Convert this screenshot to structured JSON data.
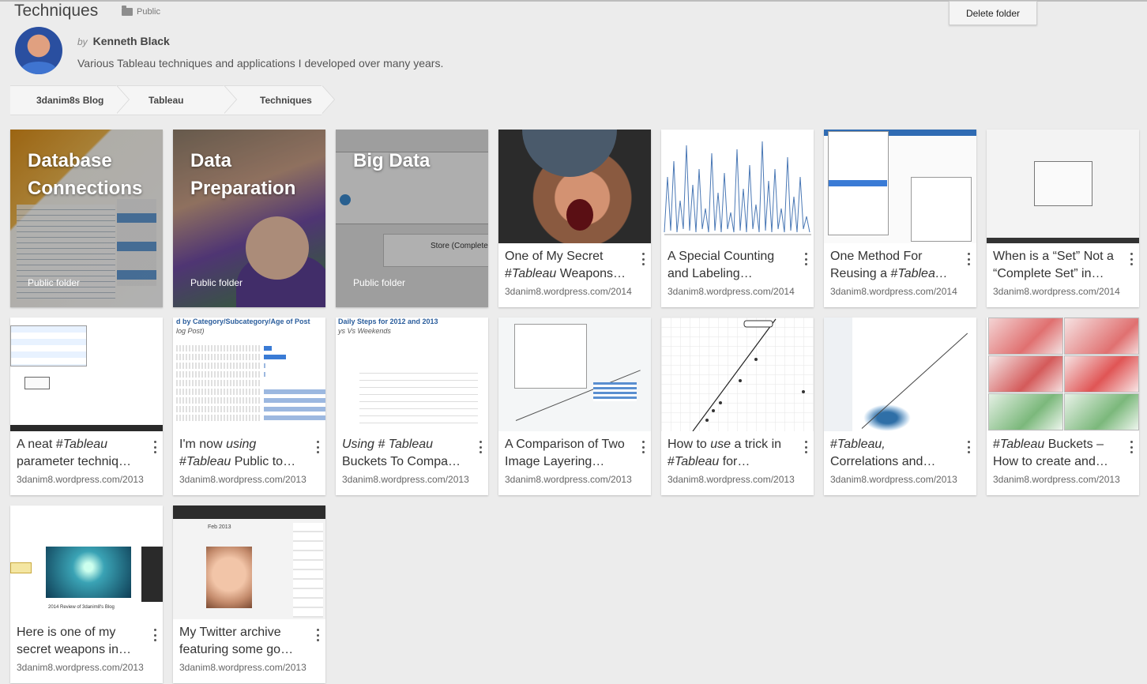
{
  "header": {
    "title": "Techniques",
    "visibility": "Public",
    "delete_label": "Delete folder",
    "by": "by",
    "author": "Kenneth Black",
    "description": "Various Tableau techniques and applications I developed over many years."
  },
  "breadcrumbs": [
    "3danim8s Blog",
    "Tableau",
    "Techniques"
  ],
  "folders": [
    {
      "title": "Database Connections",
      "sub": "Public folder"
    },
    {
      "title": "Data Preparation",
      "sub": "Public folder"
    },
    {
      "title": "Big Data",
      "sub": "Public folder"
    }
  ],
  "thumb_text": {
    "bars_header": "d by Category/Subcategory/Age of Post",
    "bars_sub": "log Post)",
    "steps_header": "Daily Steps for 2012 and 2013",
    "steps_sub": "ys Vs Weekends",
    "store": "Store (Complete",
    "fireworks": "2014 Review of 3danim8's Blog",
    "twitter": "Feb 2013"
  },
  "posts": [
    {
      "line1": [
        "One of My Secret",
        ""
      ],
      "line2": [
        "#",
        "Tableau",
        " Weapons…"
      ],
      "url": "3danim8.wordpress.com/2014"
    },
    {
      "line1": [
        "A Special Counting",
        ""
      ],
      "line2": [
        "and Labeling…",
        "",
        ""
      ],
      "url": "3danim8.wordpress.com/2014"
    },
    {
      "line1": [
        "One Method For",
        ""
      ],
      "line2": [
        "Reusing a #",
        "Tablea…",
        ""
      ],
      "url": "3danim8.wordpress.com/2014"
    },
    {
      "line1": [
        "When is a “Set” Not a",
        ""
      ],
      "line2": [
        "“Complete Set” in…",
        "",
        ""
      ],
      "url": "3danim8.wordpress.com/2014"
    },
    {
      "line1": [
        "A neat #",
        "Tableau"
      ],
      "line2": [
        "parameter techniq…",
        "",
        ""
      ],
      "url": "3danim8.wordpress.com/2013"
    },
    {
      "line1": [
        "I'm now ",
        "using"
      ],
      "line2": [
        "#",
        "Tableau",
        " Public to…"
      ],
      "url": "3danim8.wordpress.com/2013"
    },
    {
      "line1": [
        "",
        "Using # Tableau"
      ],
      "line2": [
        "Buckets To Compa…",
        "",
        ""
      ],
      "url": "3danim8.wordpress.com/2013"
    },
    {
      "line1": [
        "A Comparison of Two",
        ""
      ],
      "line2": [
        "Image Layering…",
        "",
        ""
      ],
      "url": "3danim8.wordpress.com/2013"
    },
    {
      "line1": [
        "How to ",
        "use"
      ],
      "line2": [
        "#",
        "Tableau",
        " for…"
      ],
      "url": "3danim8.wordpress.com/2013",
      "suffix1": " a trick in"
    },
    {
      "line1": [
        "#",
        "Tableau,"
      ],
      "line2": [
        "Correlations and…",
        "",
        ""
      ],
      "url": "3danim8.wordpress.com/2013"
    },
    {
      "line1": [
        "#",
        "Tableau"
      ],
      "line2": [
        "How to create and…",
        "",
        ""
      ],
      "url": "3danim8.wordpress.com/2013",
      "suffix1": " Buckets –"
    },
    {
      "line1": [
        "Here is one of my",
        ""
      ],
      "line2": [
        "secret weapons in…",
        "",
        ""
      ],
      "url": "3danim8.wordpress.com/2013"
    },
    {
      "line1": [
        "My Twitter archive",
        ""
      ],
      "line2": [
        "featuring some go…",
        "",
        ""
      ],
      "url": "3danim8.wordpress.com/2013"
    }
  ],
  "colors": {
    "accent_blue": "#3a7bd5",
    "map_red": "#e07070",
    "map_green": "#7bb87b"
  }
}
